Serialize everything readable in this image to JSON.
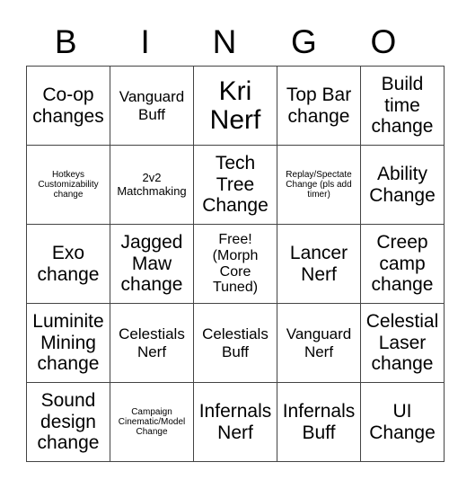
{
  "header": [
    "B",
    "I",
    "N",
    "G",
    "O"
  ],
  "rows": [
    [
      {
        "text": "Co-op changes",
        "size": "s22"
      },
      {
        "text": "Vanguard Buff",
        "size": "s17"
      },
      {
        "text": "Kri Nerf",
        "size": "s28"
      },
      {
        "text": "Top Bar change",
        "size": "s22"
      },
      {
        "text": "Build time change",
        "size": "s22"
      }
    ],
    [
      {
        "text": "Hotkeys Customizability change",
        "size": "s10"
      },
      {
        "text": "2v2 Matchmaking",
        "size": "s13"
      },
      {
        "text": "Tech Tree Change",
        "size": "s22"
      },
      {
        "text": "Replay/Spectate Change (pls add timer)",
        "size": "s10"
      },
      {
        "text": "Ability Change",
        "size": "s22"
      }
    ],
    [
      {
        "text": "Exo change",
        "size": "s22"
      },
      {
        "text": "Jagged Maw change",
        "size": "s22"
      },
      {
        "text": "Free! (Morph Core Tuned)",
        "size": "s16"
      },
      {
        "text": "Lancer Nerf",
        "size": "s22"
      },
      {
        "text": "Creep camp change",
        "size": "s22"
      }
    ],
    [
      {
        "text": "Luminite Mining change",
        "size": "s22"
      },
      {
        "text": "Celestials Nerf",
        "size": "s17"
      },
      {
        "text": "Celestials Buff",
        "size": "s17"
      },
      {
        "text": "Vanguard Nerf",
        "size": "s17"
      },
      {
        "text": "Celestial Laser change",
        "size": "s22"
      }
    ],
    [
      {
        "text": "Sound design change",
        "size": "s22"
      },
      {
        "text": "Campaign Cinematic/Model Change",
        "size": "s10"
      },
      {
        "text": "Infernals Nerf",
        "size": "s22"
      },
      {
        "text": "Infernals Buff",
        "size": "s22"
      },
      {
        "text": "UI Change",
        "size": "s22"
      }
    ]
  ]
}
